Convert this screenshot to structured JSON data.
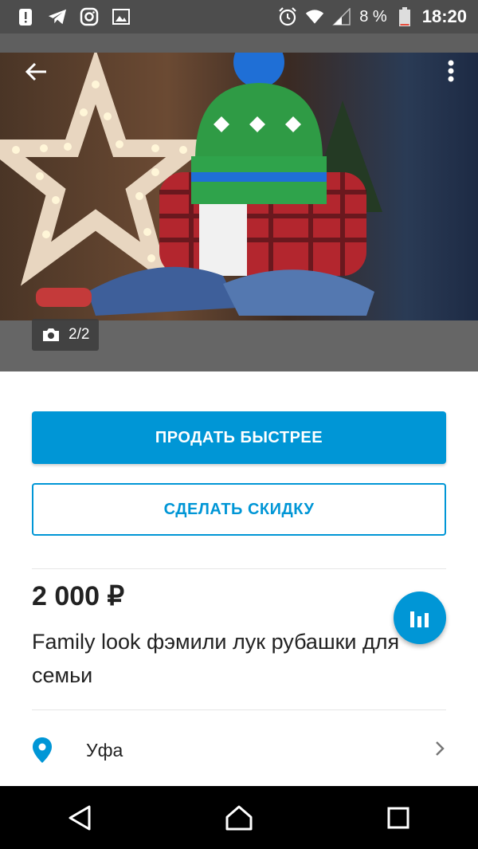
{
  "status_bar": {
    "battery_percent": "8 %",
    "time": "18:20",
    "icons": [
      "alert-icon",
      "telegram-icon",
      "instagram-icon",
      "gallery-icon",
      "alarm-icon",
      "wifi-icon",
      "signal-icon",
      "battery-icon"
    ]
  },
  "photo": {
    "counter": "2/2"
  },
  "actions": {
    "sell_faster": "ПРОДАТЬ БЫСТРЕЕ",
    "make_discount": "СДЕЛАТЬ СКИДКУ"
  },
  "listing": {
    "price": "2 000 ₽",
    "title": "Family look фэмили лук рубашки для семьи",
    "location": "Уфа"
  },
  "colors": {
    "accent": "#0096d6",
    "status_bar": "#4d4d4d",
    "nav_bar": "#000000"
  }
}
